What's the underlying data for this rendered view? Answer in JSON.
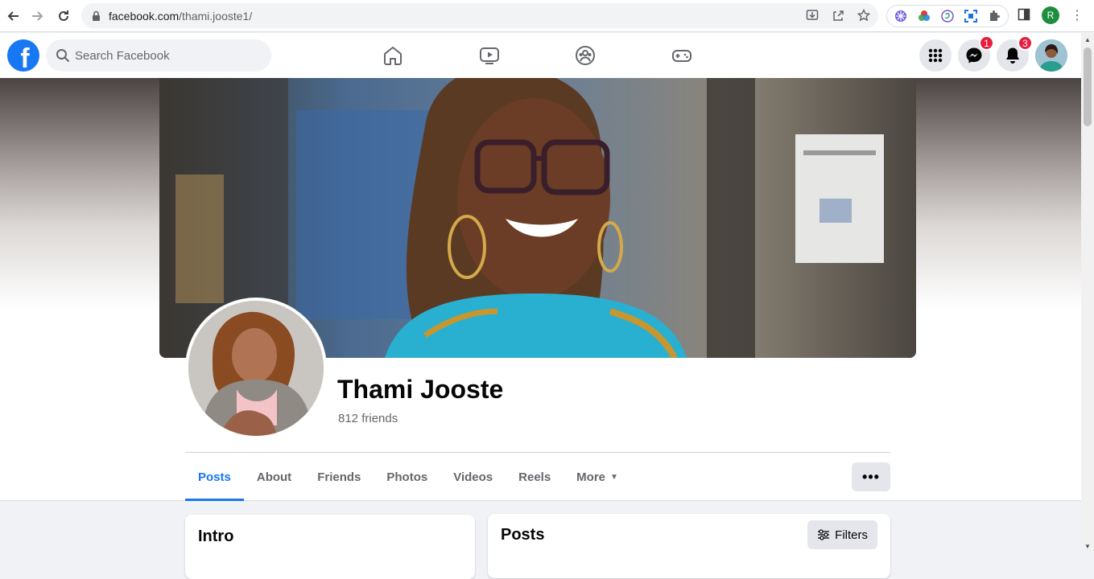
{
  "browser": {
    "url_host": "facebook.com",
    "url_path": "/thami.jooste1/",
    "profile_initial": "R"
  },
  "header": {
    "search_placeholder": "Search Facebook",
    "messenger_badge": "1",
    "notifications_badge": "3",
    "nav_tabs": [
      "home-icon",
      "watch-icon",
      "groups-icon",
      "gaming-icon"
    ]
  },
  "profile": {
    "name": "Thami Jooste",
    "friends": "812 friends",
    "tabs": [
      {
        "label": "Posts",
        "active": true
      },
      {
        "label": "About"
      },
      {
        "label": "Friends"
      },
      {
        "label": "Photos"
      },
      {
        "label": "Videos"
      },
      {
        "label": "Reels"
      },
      {
        "label": "More"
      }
    ],
    "more_options": "•••"
  },
  "cards": {
    "intro_title": "Intro",
    "posts_title": "Posts",
    "filters_label": "Filters"
  },
  "colors": {
    "brand": "#1877f2",
    "badge": "#e41e3f"
  }
}
